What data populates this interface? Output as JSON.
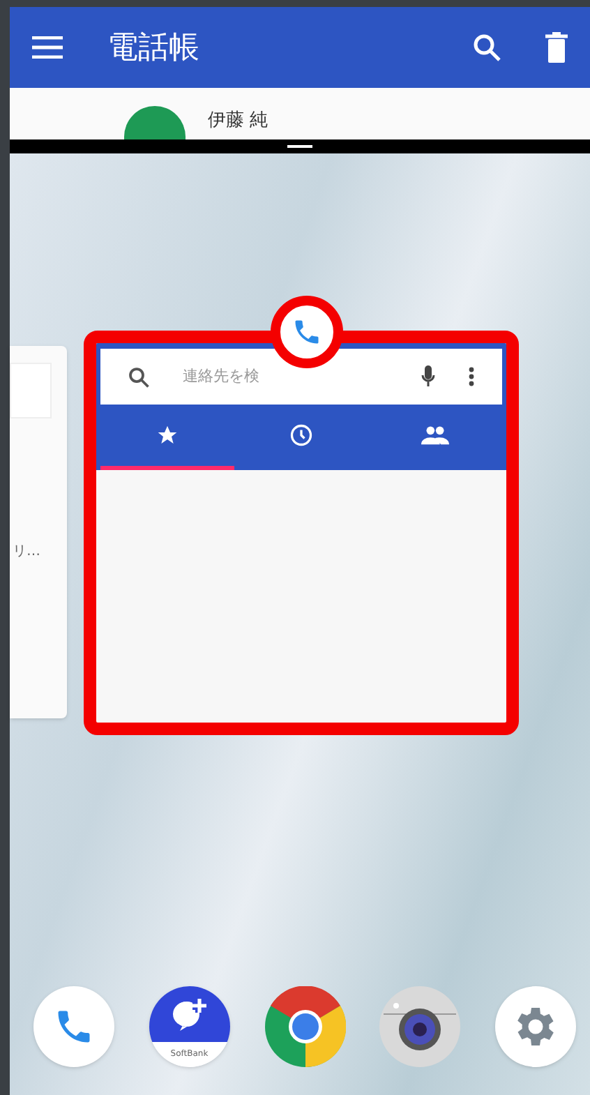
{
  "top_app": {
    "title": "電話帳",
    "contact_name": "伊藤 純"
  },
  "side_card": {
    "text": "リ…"
  },
  "floating_window": {
    "search": {
      "placeholder": "連絡先を検"
    },
    "tabs": [
      {
        "kind": "favorites",
        "selected": true
      },
      {
        "kind": "recent",
        "selected": false
      },
      {
        "kind": "contacts",
        "selected": false
      }
    ]
  },
  "dock": [
    {
      "kind": "phone"
    },
    {
      "kind": "softbank",
      "label": "SoftBank"
    },
    {
      "kind": "chrome"
    },
    {
      "kind": "camera"
    },
    {
      "kind": "settings"
    }
  ]
}
